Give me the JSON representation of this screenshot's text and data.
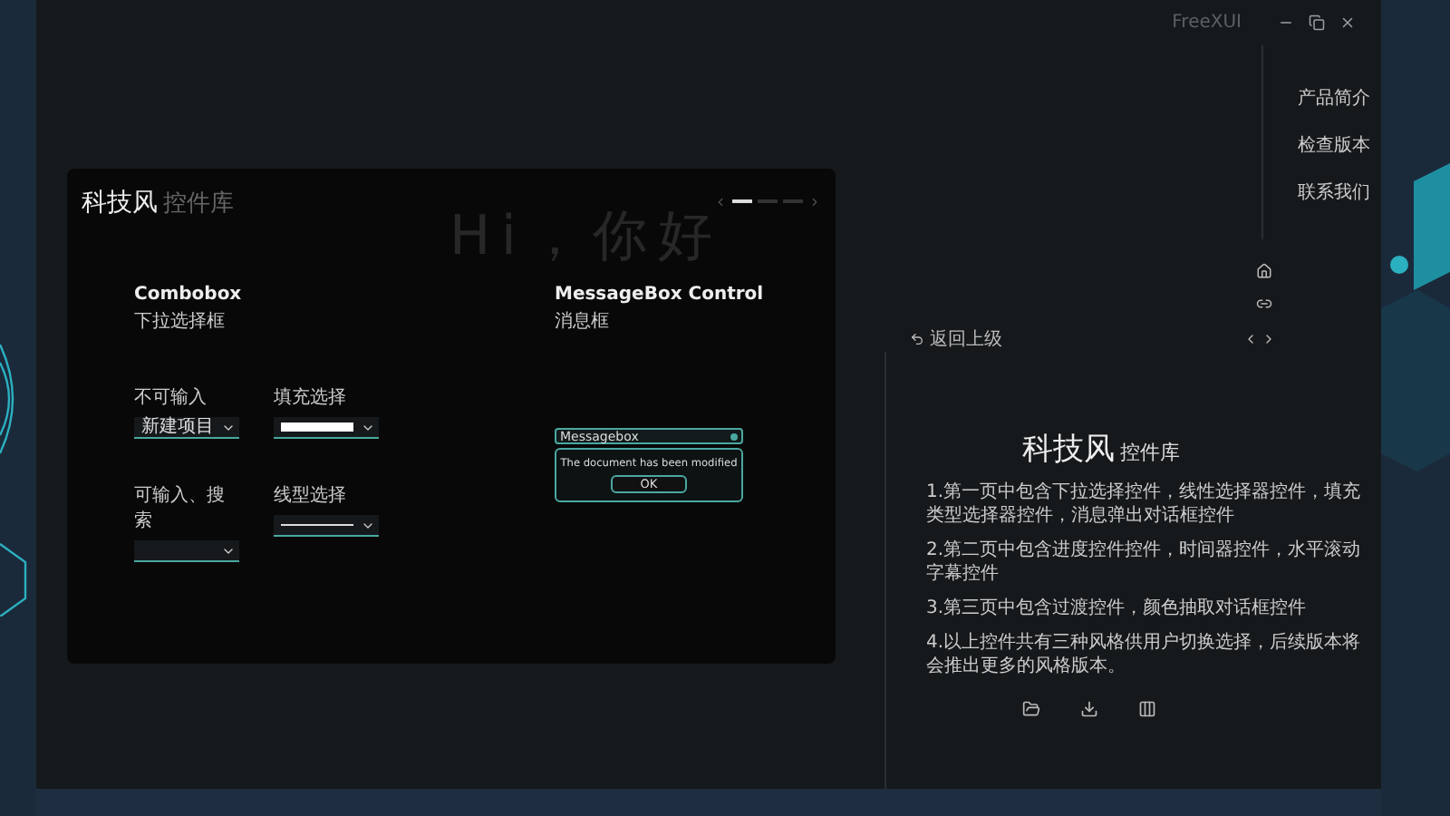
{
  "window": {
    "title": "FreeXUI"
  },
  "background_text": "Hi，你好",
  "card": {
    "title": "科技风",
    "subtitle": "控件库",
    "pages": [
      {
        "selected": true
      },
      {
        "selected": false
      },
      {
        "selected": false
      }
    ],
    "combobox": {
      "title": "Combobox",
      "subtitle": "下拉选择框",
      "fields": [
        {
          "kind": "text",
          "label": "不可输入",
          "value": "新建项目"
        },
        {
          "kind": "fill",
          "label": "填充选择"
        },
        {
          "kind": "search",
          "label": "可输入、搜索"
        },
        {
          "kind": "line",
          "label": "线型选择"
        }
      ]
    },
    "messagebox": {
      "title": "MessageBox Control",
      "subtitle": "消息框",
      "box_title": "Messagebox",
      "message": "The document has been modified",
      "button": "OK"
    }
  },
  "nav": {
    "items": [
      "产品简介",
      "检查版本",
      "联系我们"
    ]
  },
  "back": "返回上级",
  "info": {
    "title": "科技风",
    "subtitle": "控件库",
    "paragraphs": [
      "1.第一页中包含下拉选择控件，线性选择器控件，填充类型选择器控件，消息弹出对话框控件",
      "2.第二页中包含进度控件控件，时间器控件，水平滚动字幕控件",
      "3.第三页中包含过渡控件，颜色抽取对话框控件",
      "4.以上控件共有三种风格供用户切换选择，后续版本将会推出更多的风格版本。"
    ]
  }
}
